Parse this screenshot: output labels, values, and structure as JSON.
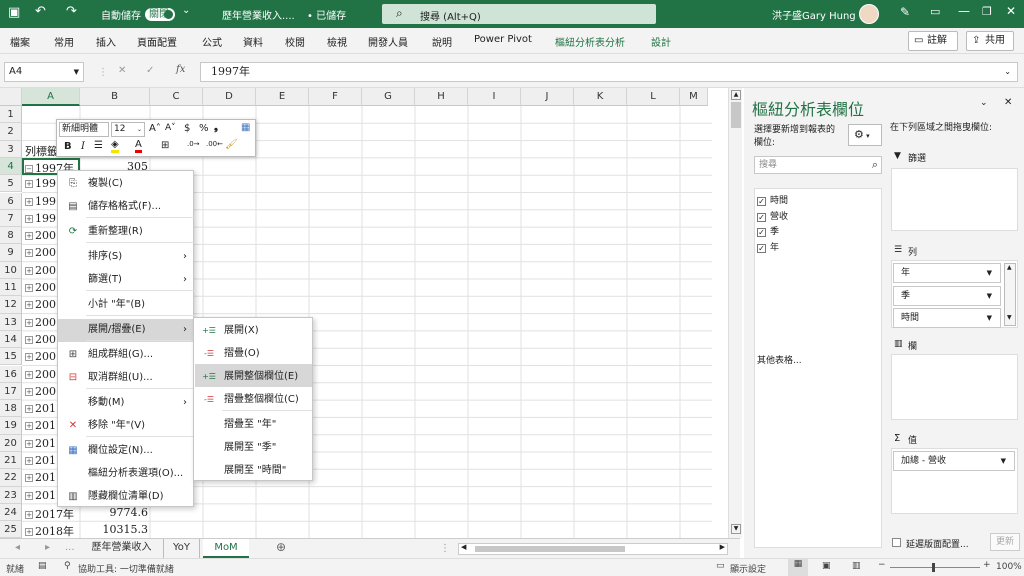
{
  "titlebar": {
    "autosave": "自動儲存",
    "autosave_state": "關閉",
    "filename": "歷年營業收入....",
    "saved": "• 已儲存",
    "search_placeholder": "搜尋 (Alt+Q)",
    "user": "洪子盛Gary Hung"
  },
  "ribbon": {
    "tabs": [
      "檔案",
      "常用",
      "插入",
      "頁面配置",
      "公式",
      "資料",
      "校閱",
      "檢視",
      "開發人員",
      "說明",
      "Power Pivot",
      "樞紐分析表分析",
      "設計"
    ],
    "comment": "註解",
    "share": "共用"
  },
  "formula": {
    "namebox": "A4",
    "value": "1997年",
    "fx": "fx"
  },
  "grid": {
    "columns": [
      "A",
      "B",
      "C",
      "D",
      "E",
      "F",
      "G",
      "H",
      "I",
      "J",
      "K",
      "L",
      "M"
    ],
    "rows": [
      "1",
      "2",
      "3",
      "4",
      "5",
      "6",
      "7",
      "8",
      "9",
      "10",
      "11",
      "12",
      "13",
      "14",
      "15",
      "16",
      "17",
      "18",
      "19",
      "20",
      "21",
      "22",
      "23",
      "24",
      "25"
    ],
    "a3": "列標籤",
    "a4": "1997年",
    "b4": "305",
    "a_partial": [
      "199",
      "199",
      "199",
      "200",
      "200",
      "200",
      "200",
      "200",
      "200",
      "200",
      "200",
      "200",
      "200",
      "201",
      "201",
      "201",
      "201",
      "201",
      "201"
    ],
    "a24": "2017年",
    "b24": "9774.6",
    "a25": "2018年",
    "b25": "10315.3"
  },
  "minitoolbar": {
    "font": "新細明體",
    "size": "12",
    "bold": "B",
    "italic": "I"
  },
  "context_menu": [
    {
      "label": "複製(C)",
      "icon": "copy-icon"
    },
    {
      "label": "儲存格格式(F)...",
      "icon": "format-cells-icon"
    },
    {
      "label": "重新整理(R)",
      "icon": "refresh-icon"
    },
    {
      "label": "排序(S)",
      "icon": ""
    },
    {
      "label": "篩選(T)",
      "icon": ""
    },
    {
      "label": "小計 \"年\"(B)",
      "icon": ""
    },
    {
      "label": "展開/摺疊(E)",
      "icon": ""
    },
    {
      "label": "組成群組(G)...",
      "icon": "group-icon"
    },
    {
      "label": "取消群組(U)...",
      "icon": "ungroup-icon"
    },
    {
      "label": "移動(M)",
      "icon": ""
    },
    {
      "label": "移除 \"年\"(V)",
      "icon": "remove-icon"
    },
    {
      "label": "欄位設定(N)...",
      "icon": "field-settings-icon"
    },
    {
      "label": "樞紐分析表選項(O)...",
      "icon": ""
    },
    {
      "label": "隱藏欄位清單(D)",
      "icon": "field-list-icon"
    }
  ],
  "submenu": [
    "展開(X)",
    "摺疊(O)",
    "展開整個欄位(E)",
    "摺疊整個欄位(C)",
    "摺疊至 \"年\"",
    "展開至 \"季\"",
    "展開至 \"時間\""
  ],
  "sheets": {
    "tabs": [
      "歷年營業收入",
      "YoY",
      "MoM"
    ],
    "active": "MoM",
    "nav": "..."
  },
  "status": {
    "ready": "就緒",
    "accessibility": "協助工具: 一切準備就緒",
    "display": "顯示設定",
    "zoom": "100%"
  },
  "pane": {
    "title": "樞紐分析表欄位",
    "choose": "選擇要新增到報表的欄位:",
    "drag": "在下列區域之間拖曳欄位:",
    "search": "搜尋",
    "fields": [
      {
        "label": "時間",
        "checked": true
      },
      {
        "label": "營收",
        "checked": true
      },
      {
        "label": "季",
        "checked": true
      },
      {
        "label": "年",
        "checked": true
      }
    ],
    "more": "其他表格...",
    "filters": "篩選",
    "rows": "列",
    "row_items": [
      "年",
      "季",
      "時間"
    ],
    "columns": "欄",
    "values": "值",
    "value_items": [
      "加總 - 營收"
    ],
    "defer": "延遲版面配置...",
    "update": "更新"
  },
  "colors": {
    "accent": "#217346",
    "selected_menu": "#d7d7d7"
  }
}
